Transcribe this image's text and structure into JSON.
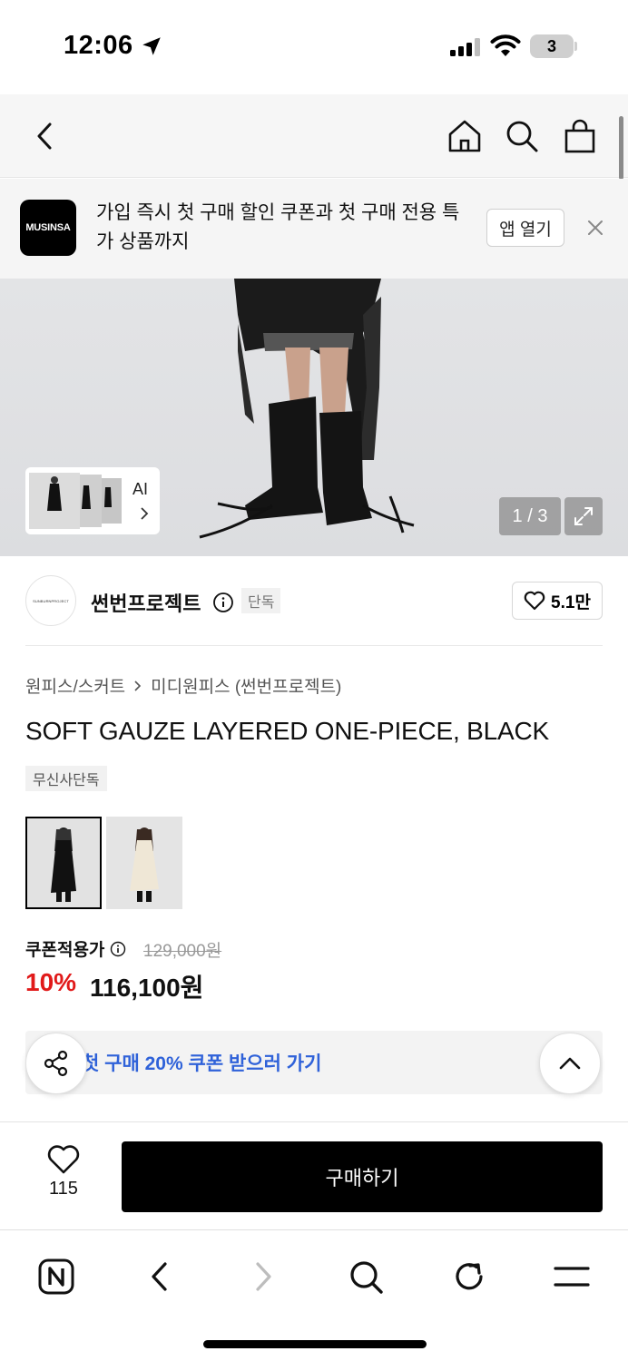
{
  "status": {
    "time": "12:06",
    "battery": "3"
  },
  "banner": {
    "logo_text": "MUSINSA",
    "message": "가입 즉시 첫 구매 할인 쿠폰과 첫 구매 전용 특가 상품까지",
    "open_app_label": "앱 열기"
  },
  "gallery": {
    "ai_label": "AI",
    "page_indicator": "1 / 3"
  },
  "brand": {
    "logo_text": "SUNBURNPROJECT",
    "name": "썬번프로젝트",
    "exclusive_tag": "단독",
    "like_count": "5.1만"
  },
  "product": {
    "breadcrumb": [
      "원피스/스커트",
      "미디원피스 (썬번프로젝트)"
    ],
    "title": "SOFT GAUZE LAYERED ONE-PIECE, BLACK",
    "tag": "무신사단독"
  },
  "price": {
    "coupon_label": "쿠폰적용가",
    "original": "129,000원",
    "discount_rate": "10%",
    "final": "116,100원"
  },
  "coupon_bar": {
    "text": "첫 구매 20% 쿠폰 받으러 가기"
  },
  "purchase": {
    "wish_count": "115",
    "buy_label": "구매하기"
  },
  "colors": {
    "accent_red": "#e11a1a",
    "link_blue": "#2f62d9",
    "black": "#000000"
  }
}
